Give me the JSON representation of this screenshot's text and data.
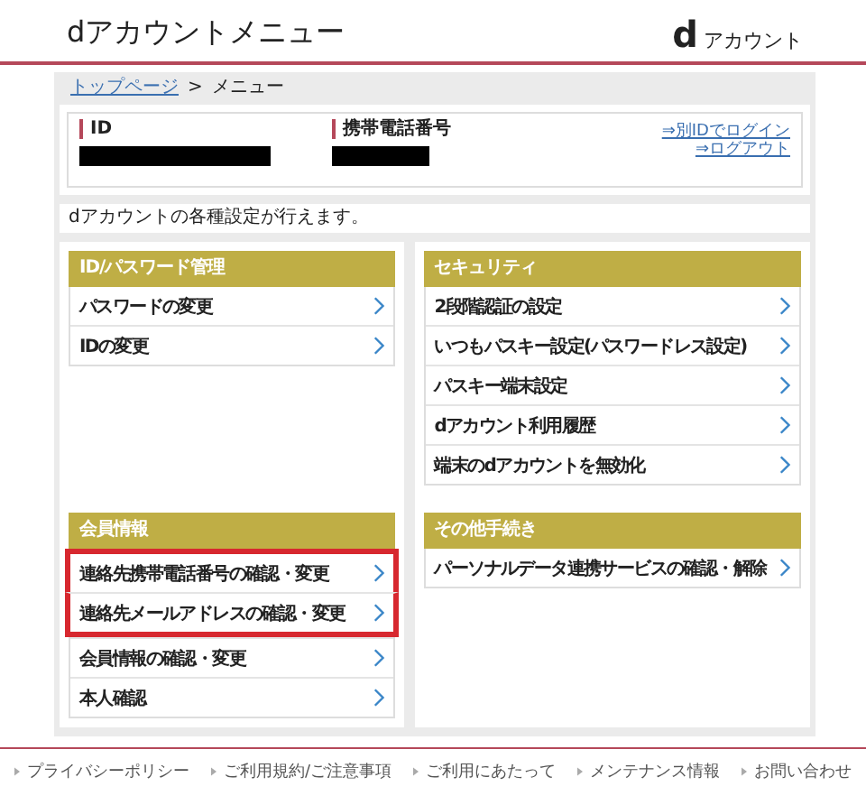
{
  "header": {
    "title": "dアカウントメニュー",
    "logo_mark": "d",
    "logo_text": "アカウント"
  },
  "breadcrumb": [
    {
      "label": "トップページ",
      "kind": "link"
    },
    {
      "label": ">",
      "kind": "separator"
    },
    {
      "label": "メニュー",
      "kind": "current"
    }
  ],
  "account": {
    "fields": [
      {
        "label": "ID"
      },
      {
        "label": "携帯電話番号"
      }
    ],
    "links": [
      "⇒別IDでログイン",
      "⇒ログアウト"
    ]
  },
  "description": "dアカウントの各種設定が行えます。",
  "sections": [
    {
      "title": "ID/パスワード管理",
      "items": [
        {
          "label": "パスワードの変更",
          "highlighted": false
        },
        {
          "label": "IDの変更",
          "highlighted": false
        }
      ]
    },
    {
      "title": "セキュリティ",
      "items": [
        {
          "label": "2段階認証の設定",
          "highlighted": false
        },
        {
          "label": "いつもパスキー設定(パスワードレス設定)",
          "highlighted": false
        },
        {
          "label": "パスキー端末設定",
          "highlighted": false
        },
        {
          "label": "dアカウント利用履歴",
          "highlighted": false
        },
        {
          "label": "端末のdアカウントを無効化",
          "highlighted": false
        }
      ]
    },
    {
      "title": "会員情報",
      "items": [
        {
          "label": "連絡先携帯電話番号の確認・変更",
          "highlighted": true
        },
        {
          "label": "連絡先メールアドレスの確認・変更",
          "highlighted": true
        },
        {
          "label": "会員情報の確認・変更",
          "highlighted": false
        },
        {
          "label": "本人確認",
          "highlighted": false
        }
      ]
    },
    {
      "title": "その他手続き",
      "items": [
        {
          "label": "パーソナルデータ連携サービスの確認・解除",
          "highlighted": false
        }
      ]
    }
  ],
  "footer": [
    "プライバシーポリシー",
    "ご利用規約/ご注意事項",
    "ご利用にあたって",
    "メンテナンス情報",
    "お問い合わせ"
  ]
}
